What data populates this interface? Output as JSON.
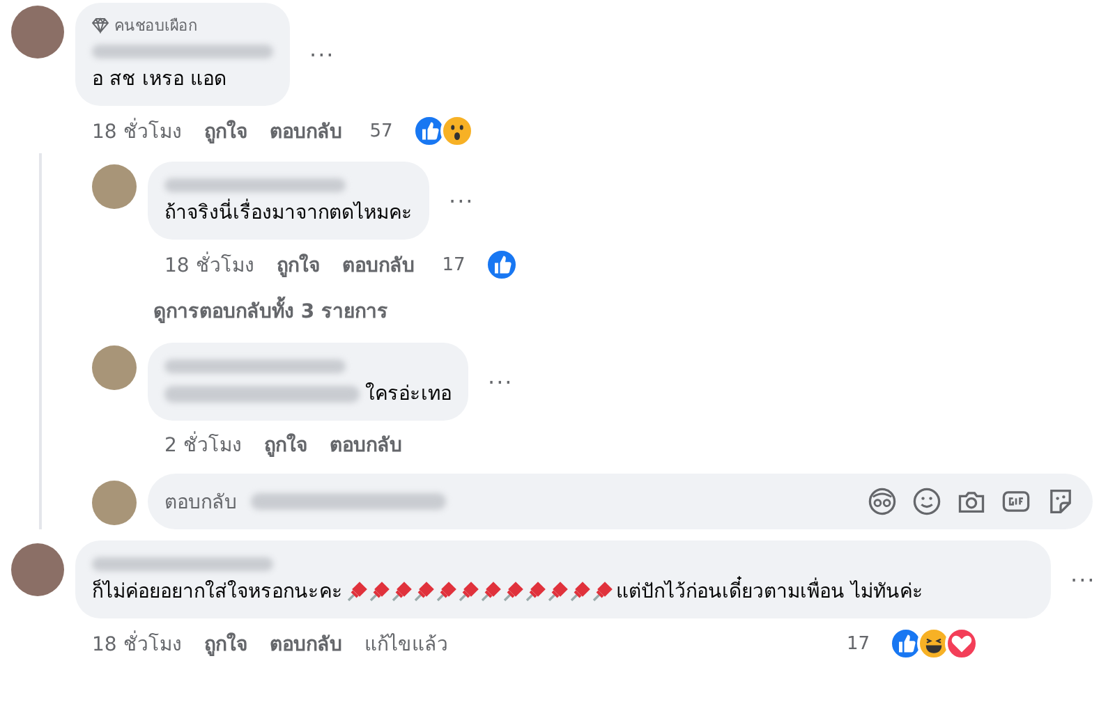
{
  "comments": [
    {
      "badge": "คนชอบเผือก",
      "text": "อ สช เหรอ แอด",
      "time": "18 ชั่วโมง",
      "like": "ถูกใจ",
      "reply": "ตอบกลับ",
      "reaction_count": "57",
      "reactions": [
        {
          "kind": "like"
        },
        {
          "kind": "wow"
        }
      ],
      "menu": "···",
      "children": [
        {
          "text": "ถ้าจริงนี่เรื่องมาจากตดไหมคะ",
          "time": "18 ชั่วโมง",
          "like": "ถูกใจ",
          "reply": "ตอบกลับ",
          "reaction_count": "17",
          "reactions": [
            {
              "kind": "like"
            }
          ],
          "menu": "···",
          "more_replies": "ดูการตอบกลับทั้ง 3 รายการ"
        },
        {
          "mention": true,
          "text": "ใครอ่ะเทอ",
          "menu": "···",
          "time": "2 ชั่วโมง",
          "like": "ถูกใจ",
          "reply": "ตอบกลับ"
        }
      ],
      "reply_box": {
        "placeholder": "ตอบกลับ"
      }
    },
    {
      "text": "ก็ไม่ค่อยอยากใส่ใจหรอกนะคะ",
      "text_after": "แต่ปักไว้ก่อนเดี๋ยวตามเพื่อน ไม่ทันค่ะ",
      "time": "18 ชั่วโมง",
      "like": "ถูกใจ",
      "reply": "ตอบกลับ",
      "edited": "แก้ไขแล้ว",
      "reaction_count": "17",
      "reactions": [
        {
          "kind": "like"
        },
        {
          "kind": "haha"
        },
        {
          "kind": "love"
        }
      ],
      "menu": "···"
    }
  ]
}
